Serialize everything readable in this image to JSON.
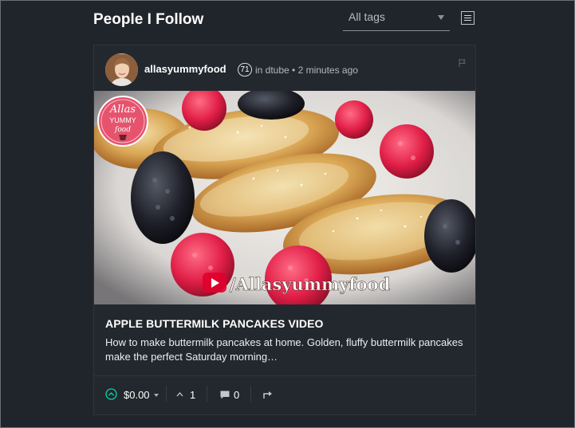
{
  "header": {
    "title": "People I Follow",
    "tags_select": "All tags"
  },
  "post": {
    "author": "allasyummyfood",
    "reputation": "71",
    "meta": "in dtube • 2 minutes ago",
    "title": "APPLE BUTTERMILK PANCAKES VIDEO",
    "excerpt": "How to make buttermilk pancakes at home. Golden, fluffy buttermilk pancakes make the perfect Saturday morning…",
    "image_watermark": "/Allasyummyfood",
    "badge_lines": [
      "Allas",
      "YUMMY",
      "food"
    ],
    "payout": "$0.00",
    "votes": "1",
    "comments": "0"
  },
  "colors": {
    "background": "#20252b",
    "card": "#23282e",
    "vote_green": "#06d6a9"
  },
  "icons": {
    "menu": "list-menu-icon",
    "flag": "flag-icon",
    "vote": "upvote-circle-icon",
    "voters": "chevron-up-icon",
    "comments": "comment-icon",
    "share": "share-icon"
  }
}
